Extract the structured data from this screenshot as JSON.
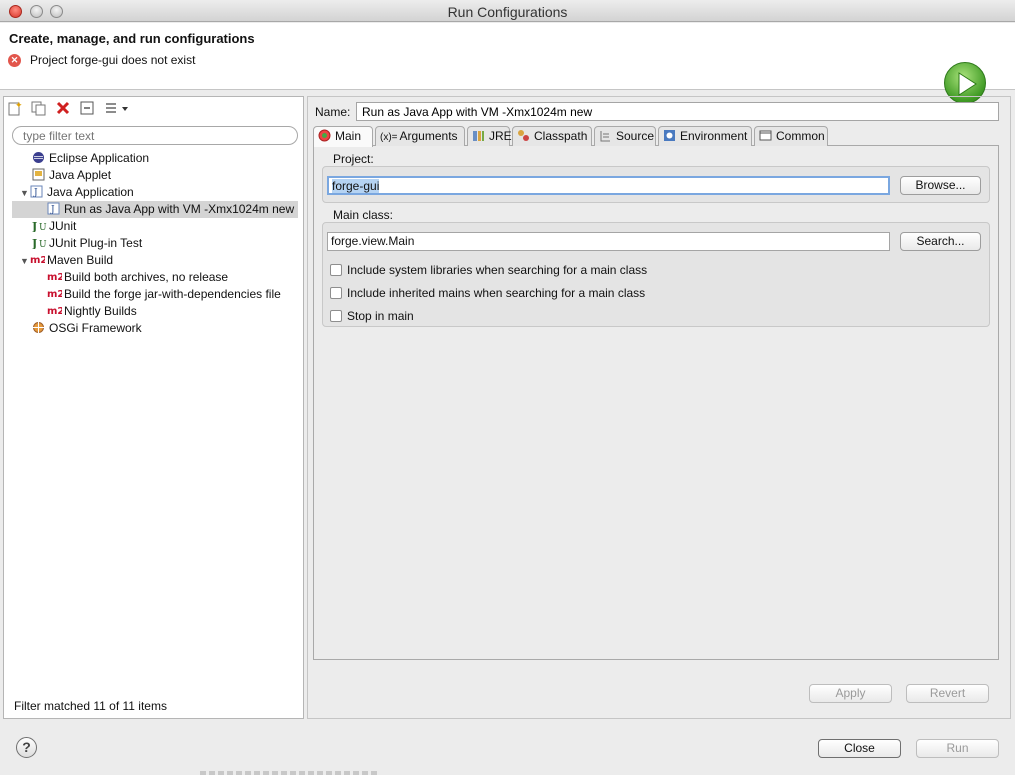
{
  "window": {
    "title": "Run Configurations"
  },
  "header": {
    "title": "Create, manage, and run configurations",
    "error_message": "Project forge-gui does not exist"
  },
  "left": {
    "filter_placeholder": "type filter text",
    "tree": [
      {
        "label": "Eclipse Application",
        "icon": "eclipse-icon",
        "level": 1
      },
      {
        "label": "Java Applet",
        "icon": "applet-icon",
        "level": 1
      },
      {
        "label": "Java Application",
        "icon": "java-app-icon",
        "level": 1,
        "expanded": true
      },
      {
        "label": "Run as Java App with VM -Xmx1024m new",
        "icon": "java-config-icon",
        "level": 2,
        "selected": true
      },
      {
        "label": "JUnit",
        "icon": "junit-icon",
        "level": 1
      },
      {
        "label": "JUnit Plug-in Test",
        "icon": "junit-plugin-icon",
        "level": 1
      },
      {
        "label": "Maven Build",
        "icon": "maven-icon",
        "level": 1,
        "expanded": true
      },
      {
        "label": "Build both archives, no release",
        "icon": "maven-icon",
        "level": 2
      },
      {
        "label": "Build the forge jar-with-dependencies file",
        "icon": "maven-icon",
        "level": 2
      },
      {
        "label": "Nightly Builds",
        "icon": "maven-icon",
        "level": 2
      },
      {
        "label": "OSGi Framework",
        "icon": "osgi-icon",
        "level": 1
      }
    ],
    "status": "Filter matched 11 of 11 items"
  },
  "config": {
    "name_label": "Name:",
    "name_value": "Run as Java App with VM -Xmx1024m new",
    "tabs": [
      {
        "label": "Main",
        "active": true
      },
      {
        "label": "Arguments"
      },
      {
        "label": "JRE"
      },
      {
        "label": "Classpath"
      },
      {
        "label": "Source"
      },
      {
        "label": "Environment"
      },
      {
        "label": "Common"
      }
    ],
    "project_label": "Project:",
    "project_value": "forge-gui",
    "browse_label": "Browse...",
    "main_class_label": "Main class:",
    "main_class_value": "forge.view.Main",
    "search_label": "Search...",
    "checkboxes": [
      {
        "label": "Include system libraries when searching for a main class",
        "checked": false
      },
      {
        "label": "Include inherited mains when searching for a main class",
        "checked": false
      },
      {
        "label": "Stop in main",
        "checked": false
      }
    ],
    "apply_label": "Apply",
    "revert_label": "Revert"
  },
  "footer": {
    "close_label": "Close",
    "run_label": "Run",
    "help_glyph": "?"
  },
  "colors": {
    "maven_red": "#c8102e",
    "run_green": "#3f9a24",
    "error_red": "#e2564c"
  }
}
